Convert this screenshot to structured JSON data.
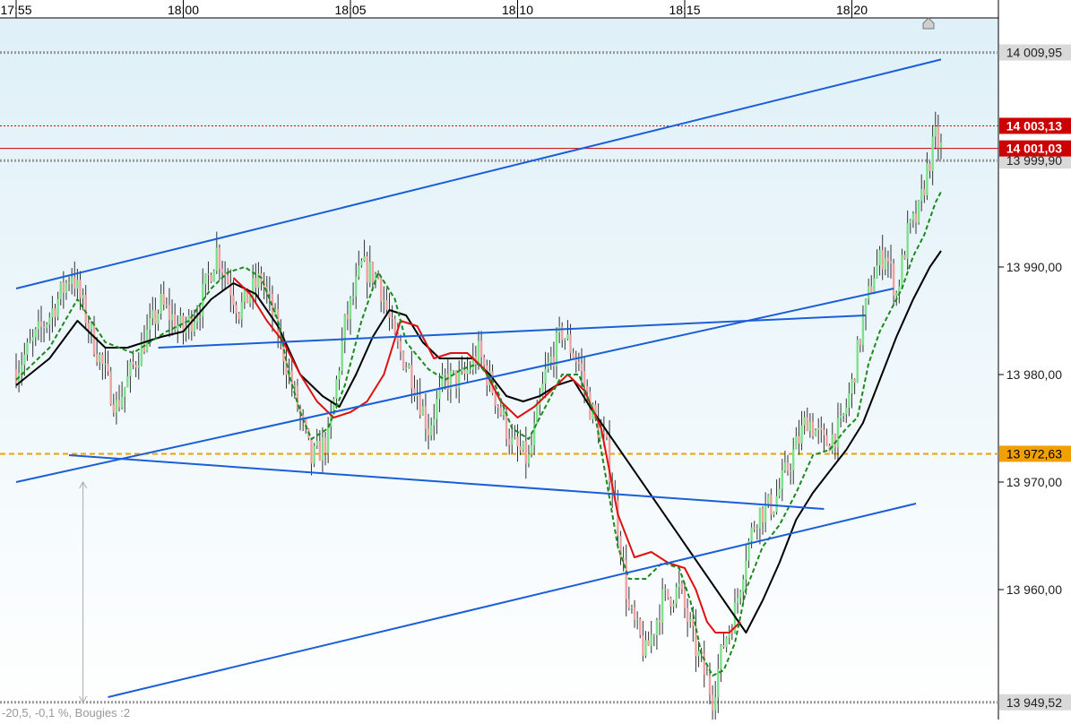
{
  "chart_data": {
    "type": "candlestick",
    "time_axis": {
      "ticks": [
        "17:55",
        "18:00",
        "18:05",
        "18:10",
        "18:15",
        "18:20"
      ],
      "start": "17:55",
      "end": "18:23"
    },
    "price_axis": {
      "ylim": [
        13949.0,
        14019.0
      ],
      "ticks": [
        13960,
        13970,
        13980,
        13990
      ],
      "tick_labels": [
        "13 960,00",
        "13 970,00",
        "13 980,00",
        "13 990,00"
      ]
    },
    "price_markers": [
      {
        "label": "14 009,95",
        "value": 14009.95,
        "kind": "grey-dotted"
      },
      {
        "label": "14 003,13",
        "value": 14003.13,
        "kind": "red-dotted"
      },
      {
        "label": "14 001,03",
        "value": 14001.03,
        "kind": "current-price"
      },
      {
        "label": "13 999,90",
        "value": 13999.9,
        "kind": "grey-dotted"
      },
      {
        "label": "13 972,63",
        "value": 13972.63,
        "kind": "orange-dashed"
      },
      {
        "label": "13 949,52",
        "value": 13949.52,
        "kind": "grey-dotted"
      }
    ],
    "colors": {
      "up_candle": "#7ee08a",
      "down_candle": "#f0a0a0",
      "wick": "#333333",
      "ma_fast": "#1a8a1a",
      "ma_mid": "#e01010",
      "ma_slow": "#000000",
      "trendlines": "#1a5ed8",
      "current_price": "#cc0000",
      "support_line": "#f0a000",
      "marker_grey": "#999999"
    },
    "path": [
      [
        "17:55:00",
        13980.5
      ],
      [
        "17:56:00",
        13985.5
      ],
      [
        "17:56:40",
        13989.5
      ],
      [
        "17:57:20",
        13983.0
      ],
      [
        "17:58:00",
        13977.0
      ],
      [
        "17:58:40",
        13982.0
      ],
      [
        "17:59:20",
        13986.5
      ],
      [
        "18:00:00",
        13984.0
      ],
      [
        "18:00:30",
        13986.5
      ],
      [
        "18:01:00",
        13991.5
      ],
      [
        "18:01:40",
        13986.0
      ],
      [
        "18:02:20",
        13989.0
      ],
      [
        "18:02:50",
        13984.0
      ],
      [
        "18:03:20",
        13978.0
      ],
      [
        "18:03:50",
        13972.0
      ],
      [
        "18:04:20",
        13974.0
      ],
      [
        "18:04:50",
        13984.5
      ],
      [
        "18:05:20",
        13990.0
      ],
      [
        "18:05:50",
        13989.0
      ],
      [
        "18:06:20",
        13983.0
      ],
      [
        "18:06:50",
        13980.0
      ],
      [
        "18:07:20",
        13975.0
      ],
      [
        "18:07:50",
        13979.5
      ],
      [
        "18:08:20",
        13979.5
      ],
      [
        "18:08:50",
        13982.0
      ],
      [
        "18:09:20",
        13978.0
      ],
      [
        "18:09:50",
        13973.5
      ],
      [
        "18:10:20",
        13972.0
      ],
      [
        "18:10:50",
        13980.0
      ],
      [
        "18:11:20",
        13984.0
      ],
      [
        "18:11:50",
        13981.0
      ],
      [
        "18:12:10",
        13977.0
      ],
      [
        "18:12:40",
        13973.0
      ],
      [
        "18:13:00",
        13966.0
      ],
      [
        "18:13:20",
        13958.0
      ],
      [
        "18:13:50",
        13954.0
      ],
      [
        "18:14:20",
        13959.0
      ],
      [
        "18:14:50",
        13960.0
      ],
      [
        "18:15:20",
        13954.5
      ],
      [
        "18:15:50",
        13950.0
      ],
      [
        "18:16:10",
        13955.0
      ],
      [
        "18:16:30",
        13958.0
      ],
      [
        "18:16:50",
        13963.5
      ],
      [
        "18:17:10",
        13967.0
      ],
      [
        "18:17:40",
        13968.0
      ],
      [
        "18:18:10",
        13972.0
      ],
      [
        "18:18:40",
        13976.0
      ],
      [
        "18:19:10",
        13973.5
      ],
      [
        "18:19:40",
        13975.0
      ],
      [
        "18:20:00",
        13979.0
      ],
      [
        "18:20:20",
        13985.0
      ],
      [
        "18:20:40",
        13989.5
      ],
      [
        "18:21:00",
        13991.5
      ],
      [
        "18:21:20",
        13987.5
      ],
      [
        "18:21:40",
        13993.0
      ],
      [
        "18:22:00",
        13995.0
      ],
      [
        "18:22:15",
        13999.0
      ],
      [
        "18:22:30",
        14002.0
      ],
      [
        "18:22:40",
        14001.0
      ]
    ],
    "ma_fast": [
      [
        "17:55:00",
        13979.5
      ],
      [
        "17:56:00",
        13982.5
      ],
      [
        "17:56:50",
        13987.0
      ],
      [
        "17:57:40",
        13983.0
      ],
      [
        "17:58:30",
        13982.0
      ],
      [
        "17:59:30",
        13984.0
      ],
      [
        "18:00:10",
        13985.0
      ],
      [
        "18:00:50",
        13988.0
      ],
      [
        "18:01:20",
        13989.5
      ],
      [
        "18:01:50",
        13990.0
      ],
      [
        "18:02:20",
        13989.0
      ],
      [
        "18:02:50",
        13985.0
      ],
      [
        "18:03:10",
        13980.0
      ],
      [
        "18:03:30",
        13976.5
      ],
      [
        "18:03:50",
        13974.0
      ],
      [
        "18:04:20",
        13975.0
      ],
      [
        "18:04:50",
        13979.0
      ],
      [
        "18:05:20",
        13985.0
      ],
      [
        "18:05:50",
        13989.5
      ],
      [
        "18:06:20",
        13987.0
      ],
      [
        "18:06:40",
        13983.0
      ],
      [
        "18:07:20",
        13980.5
      ],
      [
        "18:07:50",
        13979.5
      ],
      [
        "18:08:20",
        13980.5
      ],
      [
        "18:08:50",
        13981.0
      ],
      [
        "18:09:20",
        13979.0
      ],
      [
        "18:09:50",
        13975.0
      ],
      [
        "18:10:20",
        13974.0
      ],
      [
        "18:10:50",
        13977.0
      ],
      [
        "18:11:20",
        13980.0
      ],
      [
        "18:11:50",
        13980.0
      ],
      [
        "18:12:20",
        13976.0
      ],
      [
        "18:12:40",
        13970.0
      ],
      [
        "18:13:00",
        13964.0
      ],
      [
        "18:13:20",
        13961.0
      ],
      [
        "18:13:50",
        13961.0
      ],
      [
        "18:14:20",
        13962.5
      ],
      [
        "18:14:50",
        13962.0
      ],
      [
        "18:15:10",
        13959.0
      ],
      [
        "18:15:30",
        13954.0
      ],
      [
        "18:15:50",
        13952.0
      ],
      [
        "18:16:10",
        13952.5
      ],
      [
        "18:16:30",
        13955.0
      ],
      [
        "18:16:50",
        13960.0
      ],
      [
        "18:17:20",
        13964.0
      ],
      [
        "18:17:50",
        13966.0
      ],
      [
        "18:18:20",
        13969.0
      ],
      [
        "18:18:50",
        13972.5
      ],
      [
        "18:19:20",
        13973.0
      ],
      [
        "18:19:50",
        13975.0
      ],
      [
        "18:20:10",
        13976.0
      ],
      [
        "18:20:30",
        13981.0
      ],
      [
        "18:20:50",
        13984.0
      ],
      [
        "18:21:10",
        13986.0
      ],
      [
        "18:21:30",
        13988.0
      ],
      [
        "18:21:50",
        13991.0
      ],
      [
        "18:22:10",
        13993.0
      ],
      [
        "18:22:30",
        13996.0
      ],
      [
        "18:22:40",
        13997.0
      ]
    ],
    "ma_mid": [
      [
        "18:01:30",
        13989.0
      ],
      [
        "18:02:00",
        13987.5
      ],
      [
        "18:02:30",
        13985.0
      ],
      [
        "18:03:00",
        13983.0
      ],
      [
        "18:03:30",
        13980.0
      ],
      [
        "18:04:00",
        13977.5
      ],
      [
        "18:04:30",
        13976.0
      ],
      [
        "18:05:00",
        13976.5
      ],
      [
        "18:05:30",
        13977.5
      ],
      [
        "18:06:00",
        13980.0
      ],
      [
        "18:06:30",
        13985.0
      ],
      [
        "18:07:00",
        13984.5
      ],
      [
        "18:07:30",
        13981.5
      ],
      [
        "18:08:00",
        13982.0
      ],
      [
        "18:08:30",
        13982.0
      ],
      [
        "18:09:00",
        13980.5
      ],
      [
        "18:09:30",
        13977.5
      ],
      [
        "18:10:00",
        13976.0
      ],
      [
        "18:10:30",
        13977.0
      ],
      [
        "18:11:00",
        13978.5
      ],
      [
        "18:11:30",
        13980.0
      ],
      [
        "18:12:00",
        13978.5
      ],
      [
        "18:12:30",
        13975.0
      ],
      [
        "18:13:00",
        13967.0
      ],
      [
        "18:13:30",
        13963.0
      ],
      [
        "18:14:00",
        13963.5
      ],
      [
        "18:14:30",
        13962.5
      ],
      [
        "18:15:00",
        13962.0
      ],
      [
        "18:15:20",
        13960.0
      ],
      [
        "18:15:40",
        13957.0
      ],
      [
        "18:15:55",
        13956.0
      ],
      [
        "18:16:20",
        13956.0
      ],
      [
        "18:16:40",
        13957.0
      ]
    ],
    "ma_slow": [
      [
        "17:55:00",
        13979.0
      ],
      [
        "17:56:00",
        13981.5
      ],
      [
        "17:56:50",
        13985.0
      ],
      [
        "17:57:40",
        13982.5
      ],
      [
        "17:58:20",
        13982.5
      ],
      [
        "17:59:20",
        13983.5
      ],
      [
        "18:00:00",
        13984.0
      ],
      [
        "18:00:50",
        13987.0
      ],
      [
        "18:01:30",
        13988.5
      ],
      [
        "18:02:10",
        13987.5
      ],
      [
        "18:02:50",
        13984.5
      ],
      [
        "18:03:30",
        13980.0
      ],
      [
        "18:04:10",
        13978.0
      ],
      [
        "18:04:40",
        13977.0
      ],
      [
        "18:05:10",
        13980.0
      ],
      [
        "18:05:40",
        13983.5
      ],
      [
        "18:06:10",
        13986.0
      ],
      [
        "18:06:40",
        13985.5
      ],
      [
        "18:07:10",
        13983.0
      ],
      [
        "18:07:40",
        13981.5
      ],
      [
        "18:08:10",
        13981.5
      ],
      [
        "18:08:40",
        13981.5
      ],
      [
        "18:09:10",
        13980.0
      ],
      [
        "18:09:40",
        13978.0
      ],
      [
        "18:10:10",
        13977.5
      ],
      [
        "18:10:40",
        13978.0
      ],
      [
        "18:11:10",
        13979.0
      ],
      [
        "18:11:40",
        13979.5
      ],
      [
        "18:12:10",
        13977.0
      ],
      [
        "18:16:50",
        13956.0
      ],
      [
        "18:17:20",
        13959.0
      ],
      [
        "18:17:50",
        13962.5
      ],
      [
        "18:18:20",
        13966.5
      ],
      [
        "18:18:50",
        13969.0
      ],
      [
        "18:19:20",
        13971.0
      ],
      [
        "18:19:50",
        13973.0
      ],
      [
        "18:20:20",
        13975.5
      ],
      [
        "18:20:50",
        13979.5
      ],
      [
        "18:21:20",
        13983.5
      ],
      [
        "18:21:50",
        13987.0
      ],
      [
        "18:22:20",
        13990.0
      ],
      [
        "18:22:40",
        13991.5
      ]
    ],
    "trendlines": [
      {
        "from": [
          "17:55:00",
          13988.0
        ],
        "to": [
          "18:22:40",
          14009.3
        ]
      },
      {
        "from": [
          "17:59:15",
          13982.5
        ],
        "to": [
          "18:20:25",
          13985.5
        ]
      },
      {
        "from": [
          "17:55:00",
          13970.0
        ],
        "to": [
          "18:21:15",
          13988.0
        ]
      },
      {
        "from": [
          "17:56:35",
          13972.5
        ],
        "to": [
          "18:19:10",
          13967.5
        ]
      },
      {
        "from": [
          "17:57:45",
          13950.0
        ],
        "to": [
          "18:21:55",
          13968.0
        ]
      }
    ],
    "measure": {
      "label": "-20,5, -0,1 %, Bougies :2",
      "at": "17:57:00",
      "from": 13970.0,
      "to": 13949.5
    }
  }
}
